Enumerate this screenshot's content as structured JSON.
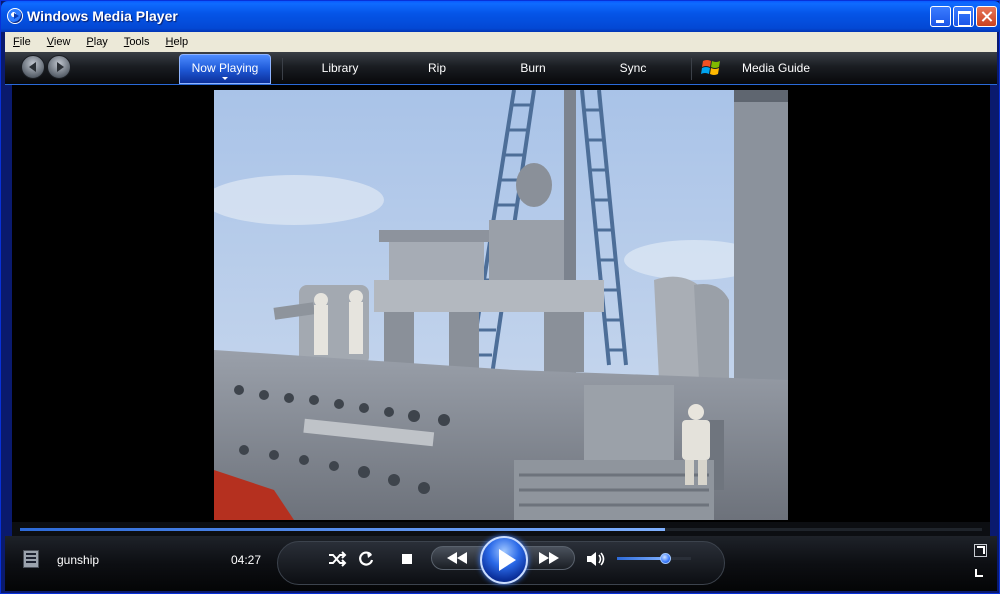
{
  "window": {
    "title": "Windows Media Player"
  },
  "menubar": {
    "items": [
      {
        "label": "File",
        "mnemonic": "F"
      },
      {
        "label": "View",
        "mnemonic": "V"
      },
      {
        "label": "Play",
        "mnemonic": "P"
      },
      {
        "label": "Tools",
        "mnemonic": "T"
      },
      {
        "label": "Help",
        "mnemonic": "H"
      }
    ]
  },
  "tabs": {
    "now_playing": "Now Playing",
    "library": "Library",
    "rip": "Rip",
    "burn": "Burn",
    "sync": "Sync",
    "media_guide": "Media Guide",
    "active": "Now Playing"
  },
  "playback": {
    "title": "gunship",
    "time": "04:27",
    "seek_progress_fraction": 0.67,
    "volume_fraction": 0.65,
    "state": "paused"
  },
  "icons": {
    "back": "back-arrow-icon",
    "forward": "forward-arrow-icon",
    "windows_logo": "windows-flag-icon",
    "shuffle": "shuffle-icon",
    "repeat": "repeat-icon",
    "stop": "stop-icon",
    "previous": "previous-icon",
    "play": "play-icon",
    "next": "next-icon",
    "mute": "volume-icon",
    "full_screen": "full-screen-icon",
    "compact_mode": "compact-mode-icon"
  },
  "colors": {
    "titlebar": "#0555e8",
    "accent": "#2b6ae8",
    "control_bar": "#0d0f13"
  }
}
